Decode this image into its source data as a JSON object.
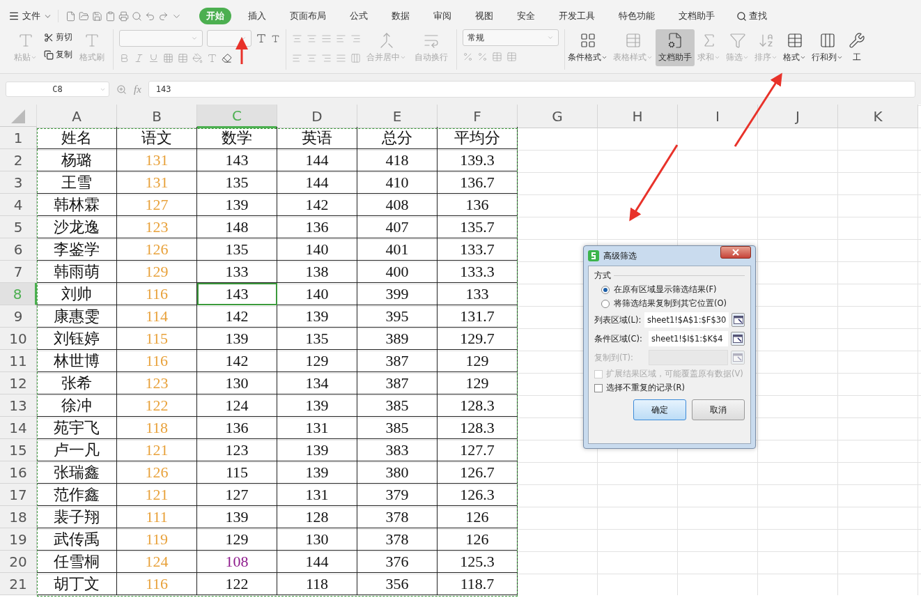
{
  "menu": {
    "file": "文件",
    "tabs": [
      {
        "label": "开始",
        "selected": true
      },
      {
        "label": "插入",
        "selected": false
      },
      {
        "label": "页面布局",
        "selected": false
      },
      {
        "label": "公式",
        "selected": false
      },
      {
        "label": "数据",
        "selected": false
      },
      {
        "label": "审阅",
        "selected": false
      },
      {
        "label": "视图",
        "selected": false
      },
      {
        "label": "安全",
        "selected": false
      },
      {
        "label": "开发工具",
        "selected": false
      },
      {
        "label": "特色功能",
        "selected": false
      },
      {
        "label": "文档助手",
        "selected": false
      }
    ],
    "search": "查找"
  },
  "ribbon": {
    "clipboard": [
      {
        "kind": "cut",
        "label": "剪切"
      },
      {
        "kind": "copy",
        "label": "复制"
      }
    ],
    "paste": {
      "label": "粘贴",
      "disabled": true,
      "dropdown": true
    },
    "brush": {
      "label": "格式刷",
      "disabled": true,
      "dropdown": false
    },
    "align_buttons": [
      {
        "kind": "merge",
        "label": "合并居中",
        "disabled": true,
        "dropdown": true
      },
      {
        "kind": "wrap",
        "label": "自动换行",
        "disabled": true,
        "dropdown": false
      }
    ],
    "number_format": "常规",
    "buttons": [
      {
        "kind": "conditional",
        "label": "条件格式",
        "disabled": false,
        "dropdown": true,
        "selected": false
      },
      {
        "kind": "tablestyle",
        "label": "表格样式",
        "disabled": true,
        "dropdown": true,
        "selected": false
      },
      {
        "kind": "assistant",
        "label": "文档助手",
        "disabled": false,
        "dropdown": false,
        "selected": true
      },
      {
        "kind": "sum",
        "label": "求和",
        "disabled": true,
        "dropdown": true,
        "selected": false
      },
      {
        "kind": "filter",
        "label": "筛选",
        "disabled": true,
        "dropdown": true,
        "selected": false
      },
      {
        "kind": "sort",
        "label": "排序",
        "disabled": true,
        "dropdown": true,
        "selected": false
      },
      {
        "kind": "format",
        "label": "格式",
        "disabled": false,
        "dropdown": true,
        "selected": false
      },
      {
        "kind": "rowcol",
        "label": "行和列",
        "disabled": false,
        "dropdown": true,
        "selected": false
      },
      {
        "kind": "tool",
        "label": "工",
        "disabled": false,
        "dropdown": false,
        "selected": false
      }
    ]
  },
  "formula_bar": {
    "cell": "C8",
    "fx": "fx",
    "value": "143"
  },
  "sheet": {
    "copy_marquee": true,
    "columns": [
      {
        "label": "A",
        "selected": false
      },
      {
        "label": "B",
        "selected": false
      },
      {
        "label": "C",
        "selected": true
      },
      {
        "label": "D",
        "selected": false
      },
      {
        "label": "E",
        "selected": false
      },
      {
        "label": "F",
        "selected": false
      },
      {
        "label": "G",
        "selected": false
      },
      {
        "label": "H",
        "selected": false
      },
      {
        "label": "I",
        "selected": false
      },
      {
        "label": "J",
        "selected": false
      },
      {
        "label": "K",
        "selected": false
      }
    ],
    "rows": [
      {
        "label": "1",
        "selected": false,
        "cells": [
          {
            "text": "姓名"
          },
          {
            "text": "语文"
          },
          {
            "text": "数学"
          },
          {
            "text": "英语"
          },
          {
            "text": "总分"
          },
          {
            "text": "平均分"
          }
        ]
      },
      {
        "label": "2",
        "selected": false,
        "cells": [
          {
            "text": "杨璐"
          },
          {
            "text": "131",
            "color": "#e8a13a"
          },
          {
            "text": "143"
          },
          {
            "text": "144"
          },
          {
            "text": "418"
          },
          {
            "text": "139.3"
          }
        ]
      },
      {
        "label": "3",
        "selected": false,
        "cells": [
          {
            "text": "王雪"
          },
          {
            "text": "131",
            "color": "#e8a13a"
          },
          {
            "text": "135"
          },
          {
            "text": "144"
          },
          {
            "text": "410"
          },
          {
            "text": "136.7"
          }
        ]
      },
      {
        "label": "4",
        "selected": false,
        "cells": [
          {
            "text": "韩林霖"
          },
          {
            "text": "127",
            "color": "#e8a13a"
          },
          {
            "text": "139"
          },
          {
            "text": "142"
          },
          {
            "text": "408"
          },
          {
            "text": "136"
          }
        ]
      },
      {
        "label": "5",
        "selected": false,
        "cells": [
          {
            "text": "沙龙逸"
          },
          {
            "text": "123",
            "color": "#e8a13a"
          },
          {
            "text": "148"
          },
          {
            "text": "136"
          },
          {
            "text": "407"
          },
          {
            "text": "135.7"
          }
        ]
      },
      {
        "label": "6",
        "selected": false,
        "cells": [
          {
            "text": "李鉴学"
          },
          {
            "text": "126",
            "color": "#e8a13a"
          },
          {
            "text": "135"
          },
          {
            "text": "140"
          },
          {
            "text": "401"
          },
          {
            "text": "133.7"
          }
        ]
      },
      {
        "label": "7",
        "selected": false,
        "cells": [
          {
            "text": "韩雨萌"
          },
          {
            "text": "129",
            "color": "#e8a13a"
          },
          {
            "text": "133"
          },
          {
            "text": "138"
          },
          {
            "text": "400"
          },
          {
            "text": "133.3"
          }
        ]
      },
      {
        "label": "8",
        "selected": true,
        "cells": [
          {
            "text": "刘帅"
          },
          {
            "text": "116",
            "color": "#e8a13a"
          },
          {
            "text": "143"
          },
          {
            "text": "140"
          },
          {
            "text": "399"
          },
          {
            "text": "133"
          }
        ]
      },
      {
        "label": "9",
        "selected": false,
        "cells": [
          {
            "text": "康惠雯"
          },
          {
            "text": "114",
            "color": "#e8a13a"
          },
          {
            "text": "142"
          },
          {
            "text": "139"
          },
          {
            "text": "395"
          },
          {
            "text": "131.7"
          }
        ]
      },
      {
        "label": "10",
        "selected": false,
        "cells": [
          {
            "text": "刘钰婷"
          },
          {
            "text": "115",
            "color": "#e8a13a"
          },
          {
            "text": "139"
          },
          {
            "text": "135"
          },
          {
            "text": "389"
          },
          {
            "text": "129.7"
          }
        ]
      },
      {
        "label": "11",
        "selected": false,
        "cells": [
          {
            "text": "林世博"
          },
          {
            "text": "116",
            "color": "#e8a13a"
          },
          {
            "text": "142"
          },
          {
            "text": "129"
          },
          {
            "text": "387"
          },
          {
            "text": "129"
          }
        ]
      },
      {
        "label": "12",
        "selected": false,
        "cells": [
          {
            "text": "张希"
          },
          {
            "text": "123",
            "color": "#e8a13a"
          },
          {
            "text": "130"
          },
          {
            "text": "134"
          },
          {
            "text": "387"
          },
          {
            "text": "129"
          }
        ]
      },
      {
        "label": "13",
        "selected": false,
        "cells": [
          {
            "text": "徐冲"
          },
          {
            "text": "122",
            "color": "#e8a13a"
          },
          {
            "text": "124"
          },
          {
            "text": "139"
          },
          {
            "text": "385"
          },
          {
            "text": "128.3"
          }
        ]
      },
      {
        "label": "14",
        "selected": false,
        "cells": [
          {
            "text": "苑宇飞"
          },
          {
            "text": "118",
            "color": "#e8a13a"
          },
          {
            "text": "136"
          },
          {
            "text": "131"
          },
          {
            "text": "385"
          },
          {
            "text": "128.3"
          }
        ]
      },
      {
        "label": "15",
        "selected": false,
        "cells": [
          {
            "text": "卢一凡"
          },
          {
            "text": "121",
            "color": "#e8a13a"
          },
          {
            "text": "123"
          },
          {
            "text": "139"
          },
          {
            "text": "383"
          },
          {
            "text": "127.7"
          }
        ]
      },
      {
        "label": "16",
        "selected": false,
        "cells": [
          {
            "text": "张瑞鑫"
          },
          {
            "text": "126",
            "color": "#e8a13a"
          },
          {
            "text": "115"
          },
          {
            "text": "139"
          },
          {
            "text": "380"
          },
          {
            "text": "126.7"
          }
        ]
      },
      {
        "label": "17",
        "selected": false,
        "cells": [
          {
            "text": "范作鑫"
          },
          {
            "text": "121",
            "color": "#e8a13a"
          },
          {
            "text": "127"
          },
          {
            "text": "131"
          },
          {
            "text": "379"
          },
          {
            "text": "126.3"
          }
        ]
      },
      {
        "label": "18",
        "selected": false,
        "cells": [
          {
            "text": "裴子翔"
          },
          {
            "text": "111",
            "color": "#e8a13a"
          },
          {
            "text": "139"
          },
          {
            "text": "128"
          },
          {
            "text": "378"
          },
          {
            "text": "126"
          }
        ]
      },
      {
        "label": "19",
        "selected": false,
        "cells": [
          {
            "text": "武传禹"
          },
          {
            "text": "119",
            "color": "#e8a13a"
          },
          {
            "text": "129"
          },
          {
            "text": "130"
          },
          {
            "text": "378"
          },
          {
            "text": "126"
          }
        ]
      },
      {
        "label": "20",
        "selected": false,
        "cells": [
          {
            "text": "任雪桐"
          },
          {
            "text": "124",
            "color": "#e8a13a"
          },
          {
            "text": "108",
            "color": "#8e1b8c"
          },
          {
            "text": "144"
          },
          {
            "text": "376"
          },
          {
            "text": "125.3"
          }
        ]
      },
      {
        "label": "21",
        "selected": false,
        "cells": [
          {
            "text": "胡丁文"
          },
          {
            "text": "116",
            "color": "#e8a13a"
          },
          {
            "text": "122"
          },
          {
            "text": "118"
          },
          {
            "text": "356"
          },
          {
            "text": "118.7"
          }
        ]
      }
    ]
  },
  "dialog": {
    "title": "高级筛选",
    "section": "方式",
    "options": [
      {
        "label": "在原有区域显示筛选结果(F)",
        "selected": true
      },
      {
        "label": "将筛选结果复制到其它位置(O)",
        "selected": false
      }
    ],
    "fields": [
      {
        "label": "列表区域(L):",
        "value": "sheet1!$A$1:$F$30",
        "disabled": false
      },
      {
        "label": "条件区域(C):",
        "value": "sheet1!$I$1:$K$4",
        "disabled": false
      },
      {
        "label": "复制到(T):",
        "disabled": true
      }
    ],
    "checkboxes": [
      {
        "label": "扩展结果区域，可能覆盖原有数据(V)",
        "checked": false,
        "disabled": true
      },
      {
        "label": "选择不重复的记录(R)",
        "checked": false,
        "disabled": false
      }
    ],
    "buttons": [
      {
        "label": "确定",
        "focused": true
      },
      {
        "label": "取消",
        "focused": false
      }
    ]
  }
}
